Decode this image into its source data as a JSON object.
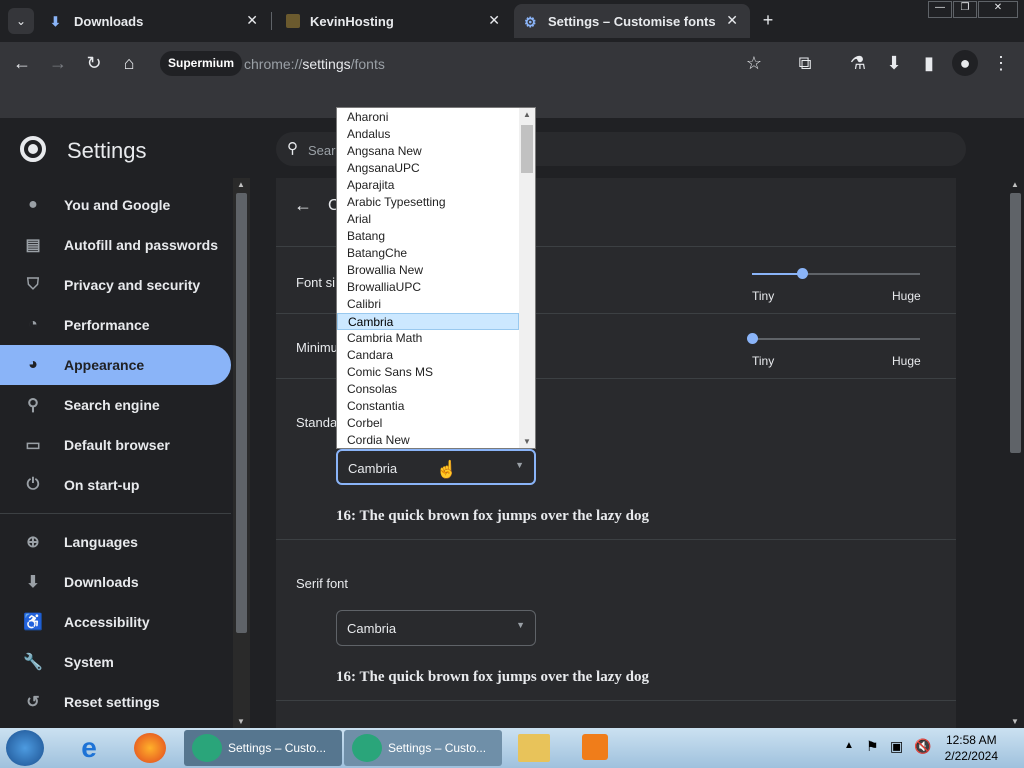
{
  "tabs": [
    {
      "label": "Downloads",
      "icon": "download-icon"
    },
    {
      "label": "KevinHosting",
      "icon": "site-favicon"
    },
    {
      "label": "Settings – Customise fonts",
      "icon": "gear-icon"
    }
  ],
  "toolbar": {
    "chip": "Supermium",
    "url_prefix": "chrome://",
    "url_main": "settings",
    "url_suffix": "/fonts"
  },
  "header": {
    "title": "Settings",
    "search_placeholder": "Search settings"
  },
  "sidebar": {
    "items": [
      {
        "label": "You and Google",
        "icon": "person-icon"
      },
      {
        "label": "Autofill and passwords",
        "icon": "clipboard-icon"
      },
      {
        "label": "Privacy and security",
        "icon": "shield-icon"
      },
      {
        "label": "Performance",
        "icon": "speedometer-icon"
      },
      {
        "label": "Appearance",
        "icon": "palette-icon"
      },
      {
        "label": "Search engine",
        "icon": "search-icon"
      },
      {
        "label": "Default browser",
        "icon": "browser-icon"
      },
      {
        "label": "On start-up",
        "icon": "power-icon"
      },
      {
        "label": "Languages",
        "icon": "globe-icon"
      },
      {
        "label": "Downloads",
        "icon": "download-icon"
      },
      {
        "label": "Accessibility",
        "icon": "accessibility-icon"
      },
      {
        "label": "System",
        "icon": "wrench-icon"
      },
      {
        "label": "Reset settings",
        "icon": "history-icon"
      }
    ],
    "active_index": 4
  },
  "page": {
    "title": "C",
    "font_size_label": "Font si",
    "min_size_label": "Minimu",
    "tiny": "Tiny",
    "huge": "Huge",
    "font_size_level": 0.3,
    "min_size_level": 0.0,
    "standard_label": "Standa",
    "standard_value": "Cambria",
    "standard_sample": "16: The quick brown fox jumps over the lazy dog",
    "serif_label": "Serif font",
    "serif_value": "Cambria",
    "serif_sample": "16: The quick brown fox jumps over the lazy dog"
  },
  "dropdown": {
    "options": [
      "Aharoni",
      "Andalus",
      "Angsana New",
      "AngsanaUPC",
      "Aparajita",
      "Arabic Typesetting",
      "Arial",
      "Batang",
      "BatangChe",
      "Browallia New",
      "BrowalliaUPC",
      "Calibri",
      "Cambria",
      "Cambria Math",
      "Candara",
      "Comic Sans MS",
      "Consolas",
      "Constantia",
      "Corbel",
      "Cordia New"
    ],
    "selected_index": 12
  },
  "taskbar": {
    "windows": [
      "Settings – Custo...",
      "Settings – Custo..."
    ],
    "time": "12:58 AM",
    "date": "2/22/2024"
  },
  "colors": {
    "accent": "#8ab4f8",
    "background": "#202124"
  }
}
